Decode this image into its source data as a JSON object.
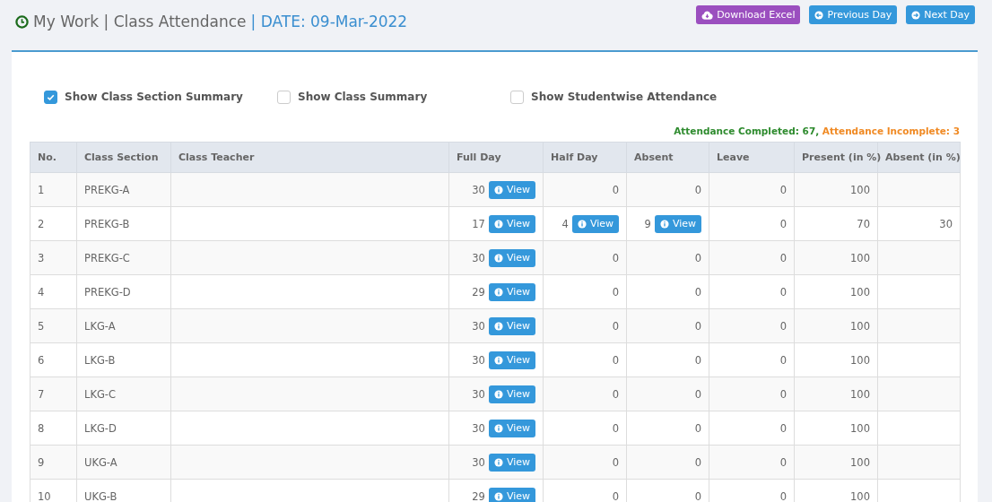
{
  "header": {
    "title": "My Work | Class Attendance",
    "date": "| DATE: 09-Mar-2022"
  },
  "actions": [
    {
      "label": "Download Excel",
      "kind": "download"
    },
    {
      "label": "Previous Day",
      "kind": "previous"
    },
    {
      "label": "Next Day",
      "kind": "next"
    }
  ],
  "options": [
    {
      "label": "Show Class Section Summary",
      "checked": true
    },
    {
      "label": "Show Class Summary",
      "checked": false
    },
    {
      "label": "Show Studentwise Attendance",
      "checked": false
    }
  ],
  "summary": {
    "completed": "Attendance Completed: 67,",
    "incomplete": "Attendance Incomplete: 3"
  },
  "table": {
    "columns": [
      "No.",
      "Class Section",
      "Class Teacher",
      "Full Day",
      "Half Day",
      "Absent",
      "Leave",
      "Present (in %)",
      "Absent (in %)"
    ],
    "rows": [
      {
        "no": "1",
        "section": "PREKG-A",
        "full_day": {
          "value": "30",
          "view": "View"
        },
        "half_day": {
          "value": "0"
        },
        "absent": {
          "value": "0"
        },
        "leave": "0",
        "present_pct": "100"
      },
      {
        "no": "2",
        "section": "PREKG-B",
        "full_day": {
          "value": "17",
          "view": "View"
        },
        "half_day": {
          "value": "4",
          "view": "View"
        },
        "absent": {
          "value": "9",
          "view": "View"
        },
        "leave": "0",
        "present_pct": "70",
        "absent_pct": "30"
      },
      {
        "no": "3",
        "section": "PREKG-C",
        "full_day": {
          "value": "30",
          "view": "View"
        },
        "half_day": {
          "value": "0"
        },
        "absent": {
          "value": "0"
        },
        "leave": "0",
        "present_pct": "100"
      },
      {
        "no": "4",
        "section": "PREKG-D",
        "full_day": {
          "value": "29",
          "view": "View"
        },
        "half_day": {
          "value": "0"
        },
        "absent": {
          "value": "0"
        },
        "leave": "0",
        "present_pct": "100"
      },
      {
        "no": "5",
        "section": "LKG-A",
        "full_day": {
          "value": "30",
          "view": "View"
        },
        "half_day": {
          "value": "0"
        },
        "absent": {
          "value": "0"
        },
        "leave": "0",
        "present_pct": "100"
      },
      {
        "no": "6",
        "section": "LKG-B",
        "full_day": {
          "value": "30",
          "view": "View"
        },
        "half_day": {
          "value": "0"
        },
        "absent": {
          "value": "0"
        },
        "leave": "0",
        "present_pct": "100"
      },
      {
        "no": "7",
        "section": "LKG-C",
        "full_day": {
          "value": "30",
          "view": "View"
        },
        "half_day": {
          "value": "0"
        },
        "absent": {
          "value": "0"
        },
        "leave": "0",
        "present_pct": "100"
      },
      {
        "no": "8",
        "section": "LKG-D",
        "full_day": {
          "value": "30",
          "view": "View"
        },
        "half_day": {
          "value": "0"
        },
        "absent": {
          "value": "0"
        },
        "leave": "0",
        "present_pct": "100"
      },
      {
        "no": "9",
        "section": "UKG-A",
        "full_day": {
          "value": "30",
          "view": "View"
        },
        "half_day": {
          "value": "0"
        },
        "absent": {
          "value": "0"
        },
        "leave": "0",
        "present_pct": "100"
      },
      {
        "no": "10",
        "section": "UKG-B",
        "full_day": {
          "value": "29",
          "view": "View"
        },
        "half_day": {
          "value": "0"
        },
        "absent": {
          "value": "0"
        },
        "leave": "0",
        "present_pct": "100"
      }
    ]
  }
}
